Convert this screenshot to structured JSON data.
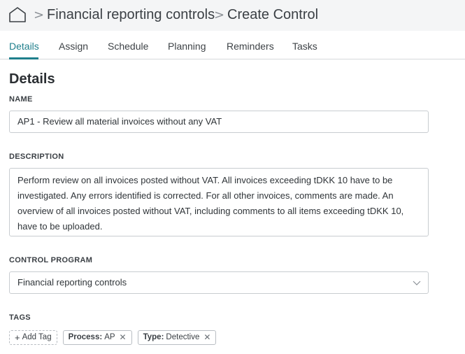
{
  "breadcrumb": {
    "items": [
      "Financial reporting controls",
      "Create Control"
    ],
    "separator": ">"
  },
  "tabs": [
    {
      "label": "Details",
      "active": true
    },
    {
      "label": "Assign"
    },
    {
      "label": "Schedule"
    },
    {
      "label": "Planning"
    },
    {
      "label": "Reminders"
    },
    {
      "label": "Tasks"
    }
  ],
  "section_title": "Details",
  "form": {
    "name": {
      "label": "NAME",
      "value": "AP1 - Review all material invoices without any VAT"
    },
    "description": {
      "label": "DESCRIPTION",
      "lines": [
        "Perform review on all invoices posted without VAT. All invoices exceeding tDKK 10 have to be",
        "investigated. Any errors identified is corrected. For all other invoices, comments are made. An",
        "overview of all invoices posted without VAT, including comments to all items exceeding tDKK 10,",
        "have to be uploaded."
      ]
    },
    "control_program": {
      "label": "CONTROL PROGRAM",
      "value": "Financial reporting controls"
    },
    "tags": {
      "label": "TAGS",
      "add_label": "Add Tag",
      "items": [
        {
          "key": "Process:",
          "value": "AP"
        },
        {
          "key": "Type:",
          "value": "Detective"
        }
      ]
    }
  },
  "colors": {
    "accent": "#1f7f8c",
    "topbar_bg": "#f4f5f6",
    "border": "#c8ccd0"
  },
  "icons": [
    "home-icon",
    "chevron-down-icon",
    "plus-icon",
    "close-icon"
  ]
}
